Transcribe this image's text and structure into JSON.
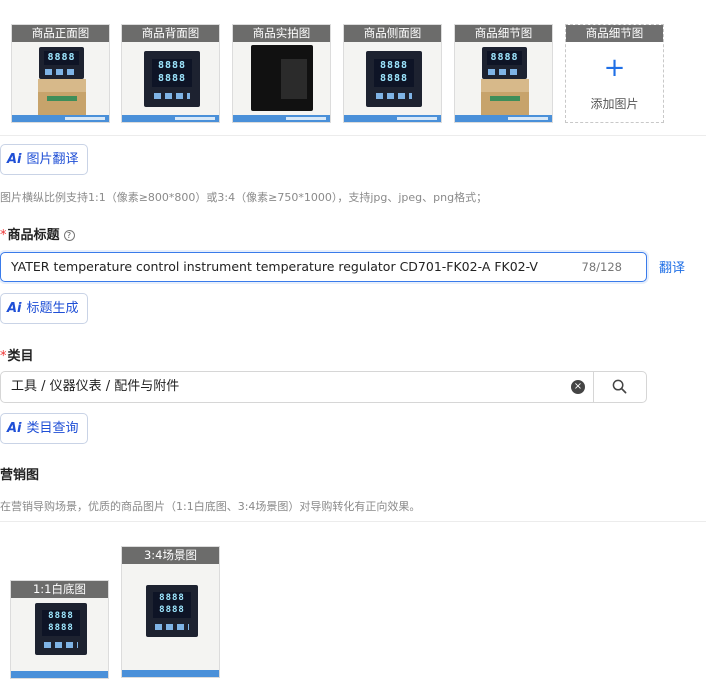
{
  "main_images": [
    {
      "label": "商品正面图"
    },
    {
      "label": "商品背面图"
    },
    {
      "label": "商品实拍图"
    },
    {
      "label": "商品侧面图"
    },
    {
      "label": "商品细节图"
    }
  ],
  "add_tile": {
    "label": "商品细节图",
    "plus": "+",
    "action": "添加图片"
  },
  "image_translate_button": "图片翻译",
  "image_hint": "图片横纵比例支持1:1（像素≥800*800）或3:4（像素≥750*1000），支持jpg、jpeg、png格式；",
  "title_section": {
    "label": "商品标题",
    "required_mark": "*",
    "help_icon": "question-circle-icon",
    "value": "YATER temperature control instrument temperature regulator CD701-FK02-A FK02-V",
    "count": "78/128",
    "translate_link": "翻译",
    "generate_button": "标题生成"
  },
  "category_section": {
    "label": "类目",
    "required_mark": "*",
    "value": "工具 / 仪器仪表 / 配件与附件",
    "clear_icon": "×",
    "query_button": "类目查询"
  },
  "marketing_section": {
    "label": "营销图",
    "hint": "在营销导购场景，优质的商品图片（1:1白底图、3:4场景图）对导购转化有正向效果。",
    "images": [
      {
        "label": "1:1白底图"
      },
      {
        "label": "3:4场景图"
      }
    ]
  },
  "ai_icon_text": "Ai",
  "colors": {
    "accent": "#1f6fe6",
    "required": "#e33333",
    "border_focus": "#3a7bea"
  }
}
